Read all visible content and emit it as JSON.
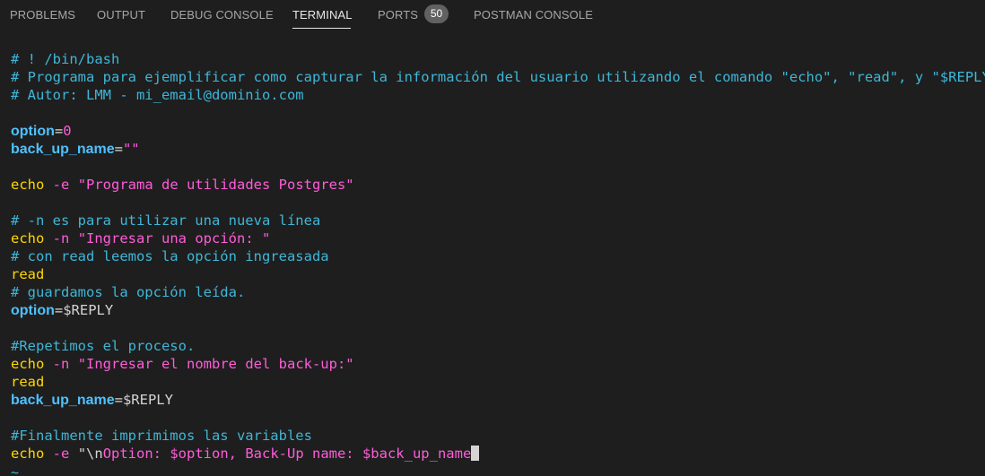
{
  "panel_tabs": [
    {
      "label": "PROBLEMS"
    },
    {
      "label": "OUTPUT"
    },
    {
      "label": "DEBUG CONSOLE"
    },
    {
      "label": "TERMINAL"
    },
    {
      "label": "PORTS"
    },
    {
      "label": "POSTMAN CONSOLE"
    }
  ],
  "ports_badge": "50",
  "editor": {
    "shebang": "# ! /bin/bash",
    "comment_desc": "# Programa para ejemplificar como capturar la información del usuario utilizando el comando \"echo\", \"read\", y \"$REPLY\".",
    "comment_author": "# Autor: LMM - mi_email@dominio.com",
    "option_var": "option",
    "option_eq": "=",
    "option_val": "0",
    "backup_var": "back_up_name",
    "backup_eq": "=",
    "backup_val": "\"\"",
    "echo_cmd": "echo",
    "flag_e": "-e",
    "flag_n": "-n",
    "title_str": "\"Programa de utilidades Postgres\"",
    "comment_newline": "# -n es para utilizar una nueva línea",
    "prompt_option_str": "\"Ingresar una opción: \"",
    "comment_read": "# con read leemos la opción ingreasada",
    "read_cmd": "read",
    "comment_saved": "# guardamos la opción leída.",
    "reply": "$REPLY",
    "comment_repeat": "#Repetimos el proceso.",
    "prompt_backup_str": "\"Ingresar el nombre del back-up:\"",
    "comment_final": "#Finalmente imprimimos las variables",
    "final_quote_open": "\"\\n",
    "final_str": "Option: $option, Back-Up name: $back_up_name",
    "final_quote_close": "\"",
    "tilde": "~"
  }
}
